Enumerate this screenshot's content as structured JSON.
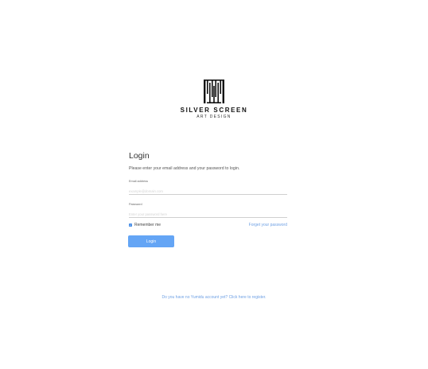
{
  "brand": {
    "logo_icon": "silver-screen-logo-icon",
    "name": "SILVER SCREEN",
    "subtitle": "ART DESIGN"
  },
  "login": {
    "title": "Login",
    "description": "Please enter your email address and your password to login.",
    "email": {
      "label": "Email address",
      "placeholder": "example@domain.com",
      "value": ""
    },
    "password": {
      "label": "Password",
      "placeholder": "Enter your password here",
      "value": ""
    },
    "remember_me": {
      "label": "Remember me",
      "checked": true
    },
    "forgot_password": "Forget your password",
    "submit_label": "Login",
    "register_text": "Do you have no Yumidu account yet? Click here to register."
  },
  "colors": {
    "accent": "#64a5f5",
    "link": "#6fa1e4",
    "checkbox": "#4a8fe7"
  }
}
